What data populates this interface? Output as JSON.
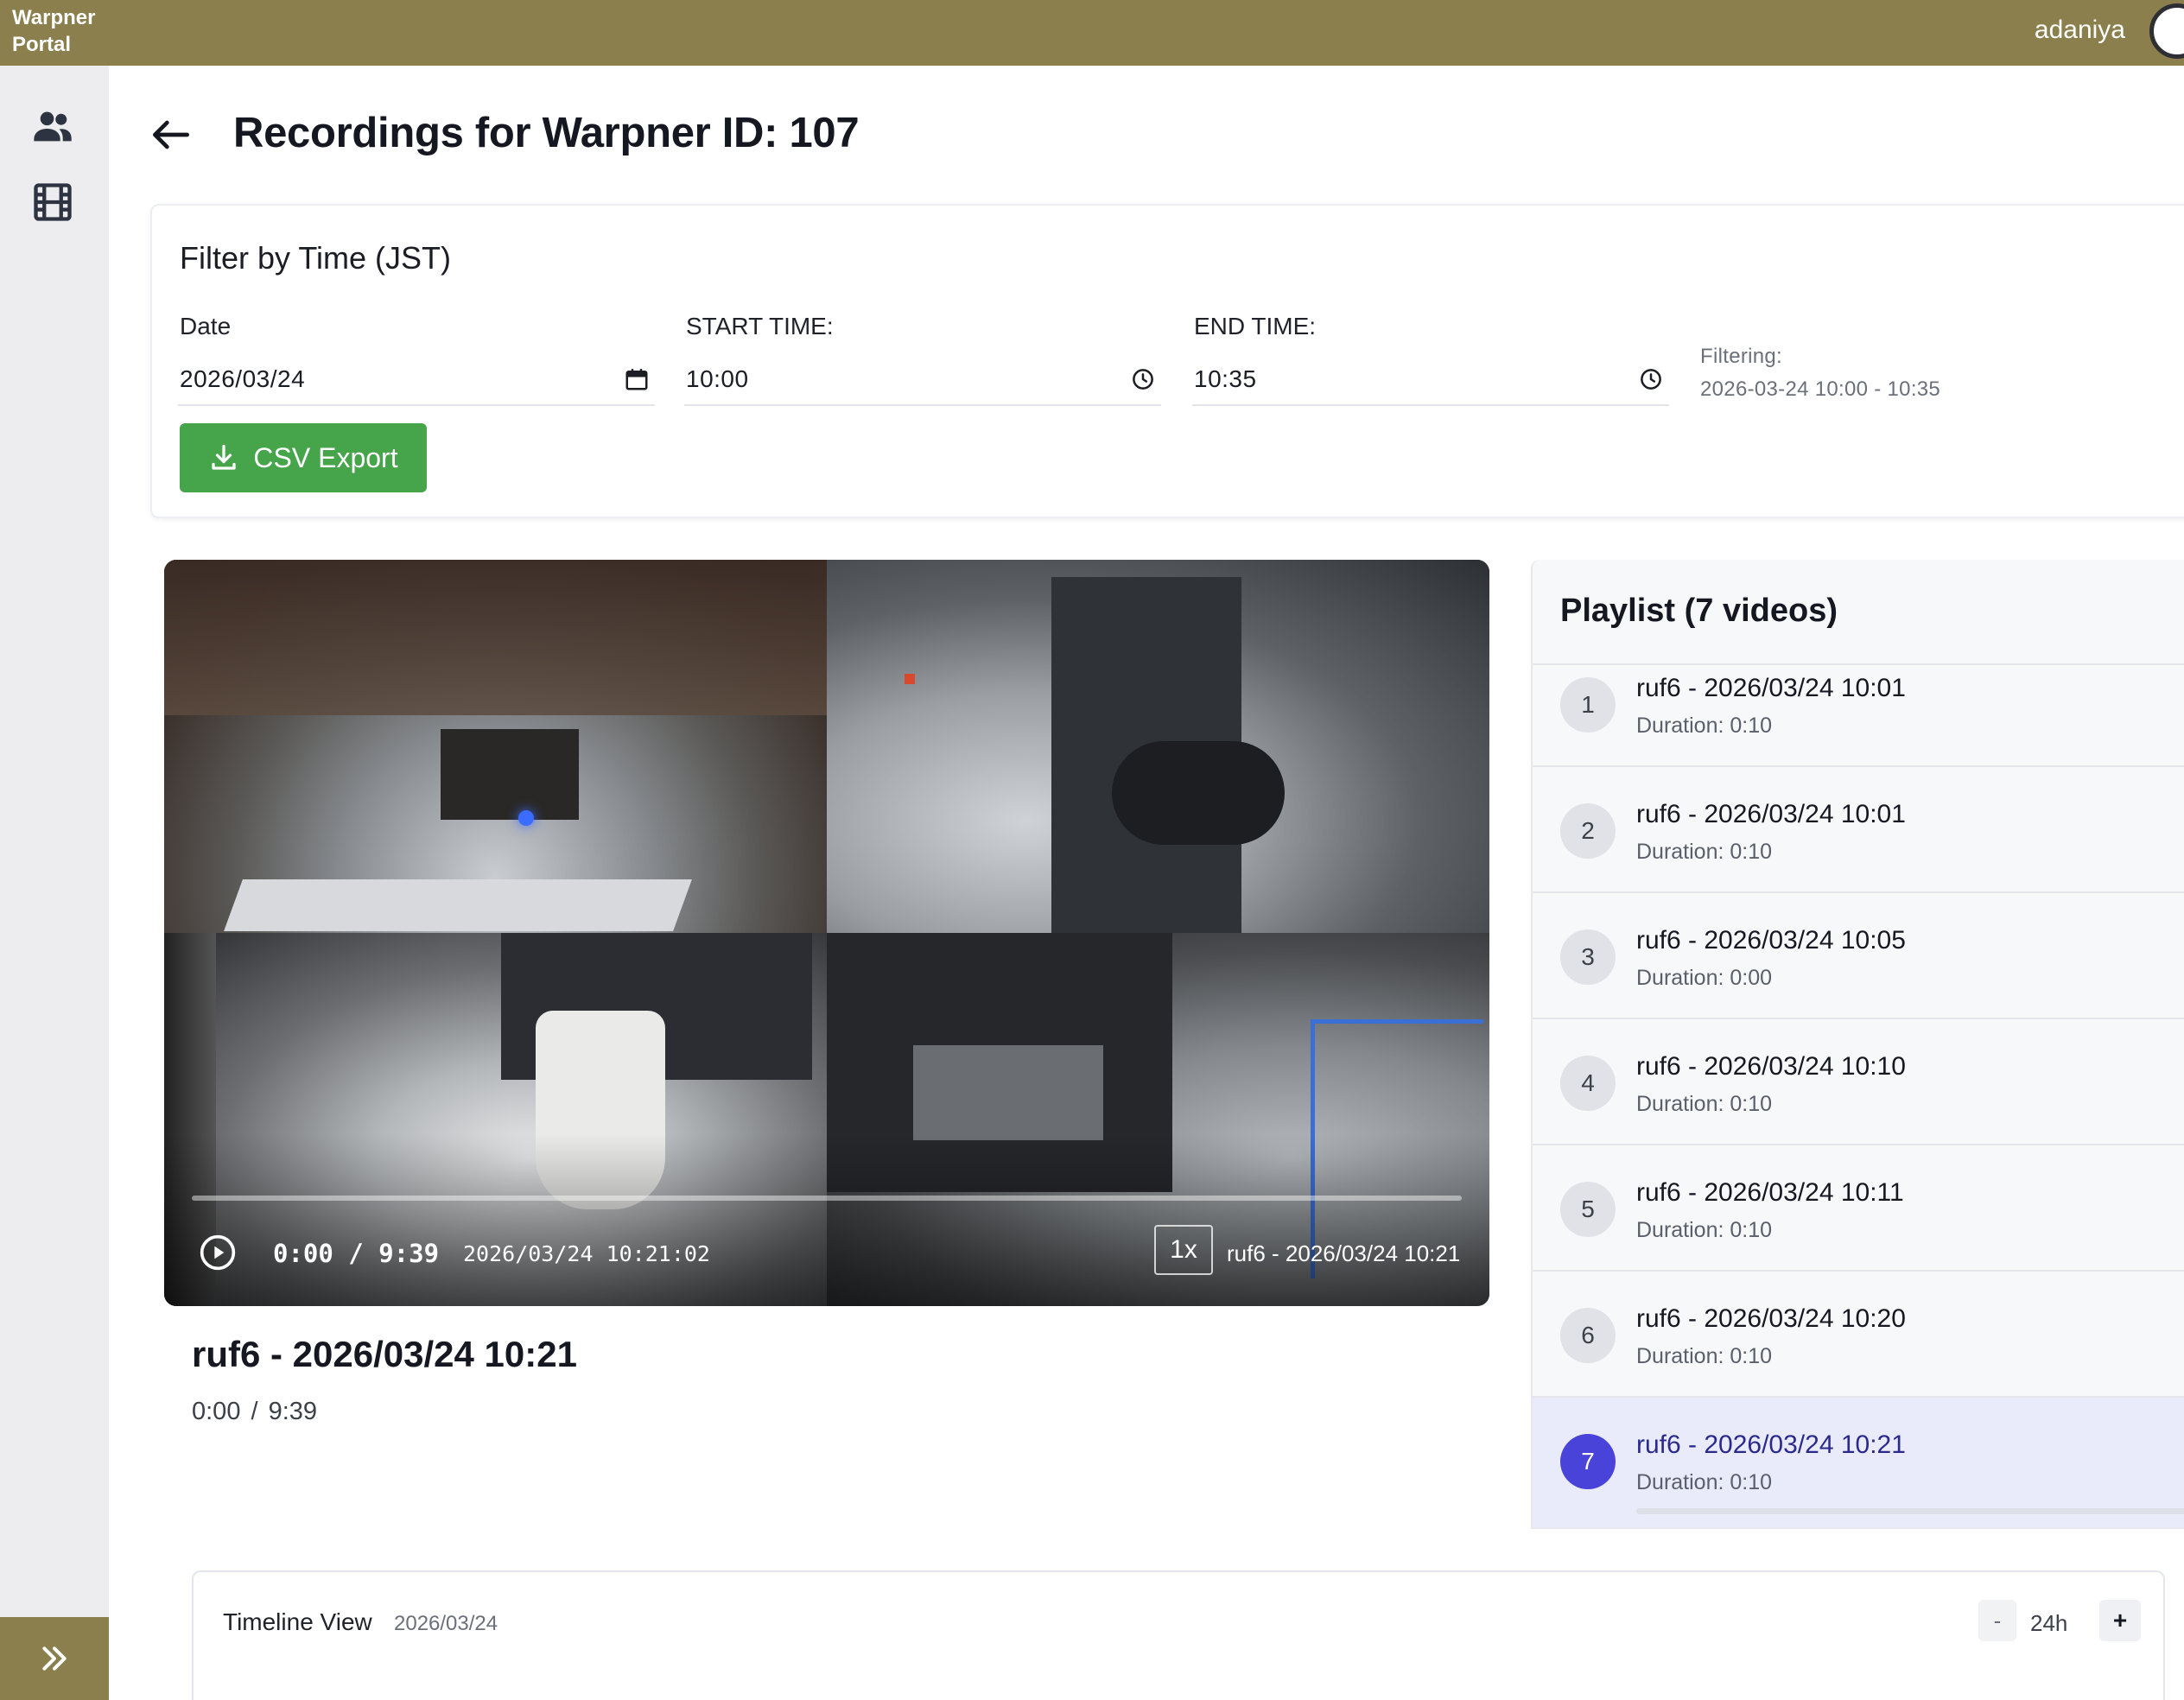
{
  "app": {
    "brand_line1": "Warpner",
    "brand_line2": "Portal",
    "username": "adaniya"
  },
  "sidebar": {
    "items": [
      {
        "icon": "users-icon"
      },
      {
        "icon": "film-icon"
      }
    ],
    "toggle_icon": "double-chevron-right-icon"
  },
  "header": {
    "title": "Recordings for Warpner ID: 107"
  },
  "filter": {
    "title": "Filter by Time (JST)",
    "date_label": "Date",
    "date_value": "2026/03/24",
    "start_label": "START TIME:",
    "start_value": "10:00",
    "end_label": "END TIME:",
    "end_value": "10:35",
    "filtering_label": "Filtering:",
    "filtering_value": "2026-03-24 10:00 - 10:35",
    "csv_button": "CSV Export"
  },
  "player": {
    "time": "0:00 / 9:39",
    "timestamp": "2026/03/24 10:21:02",
    "speed": "1x",
    "caption": "ruf6 - 2026/03/24 10:21",
    "progress_fraction": 0,
    "now_playing_title": "ruf6 - 2026/03/24 10:21",
    "now_playing_time": "0:00 / 9:39"
  },
  "playlist": {
    "title": "Playlist (7 videos)",
    "active_index": 7,
    "items": [
      {
        "num": "1",
        "name": "ruf6 - 2026/03/24 10:01",
        "duration": "Duration: 0:10"
      },
      {
        "num": "2",
        "name": "ruf6 - 2026/03/24 10:01",
        "duration": "Duration: 0:10"
      },
      {
        "num": "3",
        "name": "ruf6 - 2026/03/24 10:05",
        "duration": "Duration: 0:00"
      },
      {
        "num": "4",
        "name": "ruf6 - 2026/03/24 10:10",
        "duration": "Duration: 0:10"
      },
      {
        "num": "5",
        "name": "ruf6 - 2026/03/24 10:11",
        "duration": "Duration: 0:10"
      },
      {
        "num": "6",
        "name": "ruf6 - 2026/03/24 10:20",
        "duration": "Duration: 0:10"
      },
      {
        "num": "7",
        "name": "ruf6 - 2026/03/24 10:21",
        "duration": "Duration: 0:10"
      }
    ]
  },
  "timeline": {
    "title": "Timeline View",
    "date": "2026/03/24",
    "zoom_out": "-",
    "zoom_level": "24h",
    "zoom_in": "+"
  },
  "colors": {
    "topbar": "#8b7f4d",
    "csv_button": "#46a44b",
    "active_badge": "#4a43d9",
    "active_row": "#e9ebfb"
  }
}
